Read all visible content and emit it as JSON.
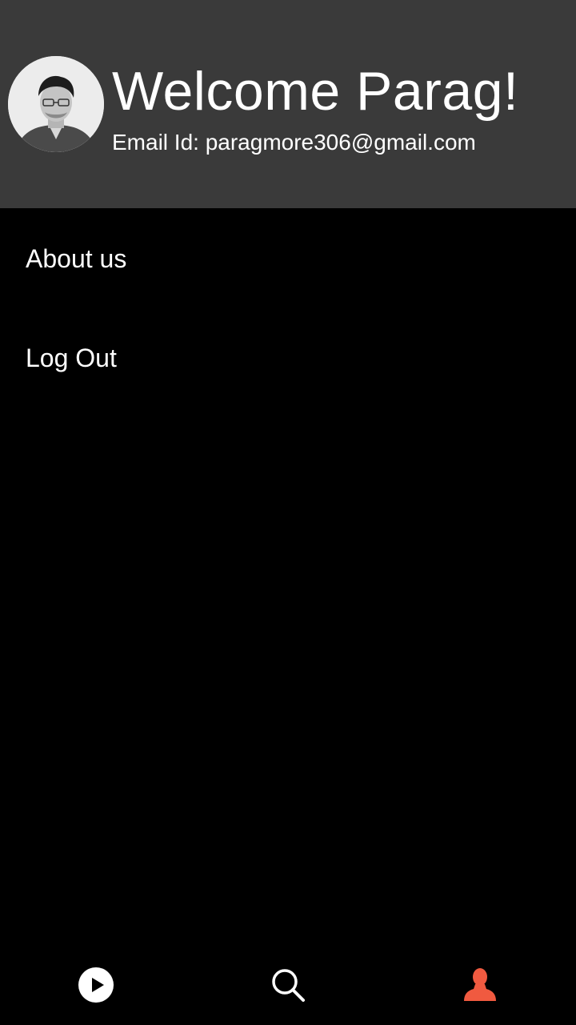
{
  "header": {
    "welcome_text": "Welcome Parag!",
    "email_text": "Email Id: paragmore306@gmail.com",
    "background_color": "#3a3a3a"
  },
  "menu": {
    "items": [
      {
        "label": "About us"
      },
      {
        "label": "Log Out"
      }
    ]
  },
  "bottom_nav": {
    "items": [
      {
        "icon": "play-circle-icon",
        "active": false
      },
      {
        "icon": "search-icon",
        "active": false
      },
      {
        "icon": "profile-icon",
        "active": true
      }
    ],
    "active_color": "#f05a40",
    "inactive_color": "#ffffff"
  }
}
